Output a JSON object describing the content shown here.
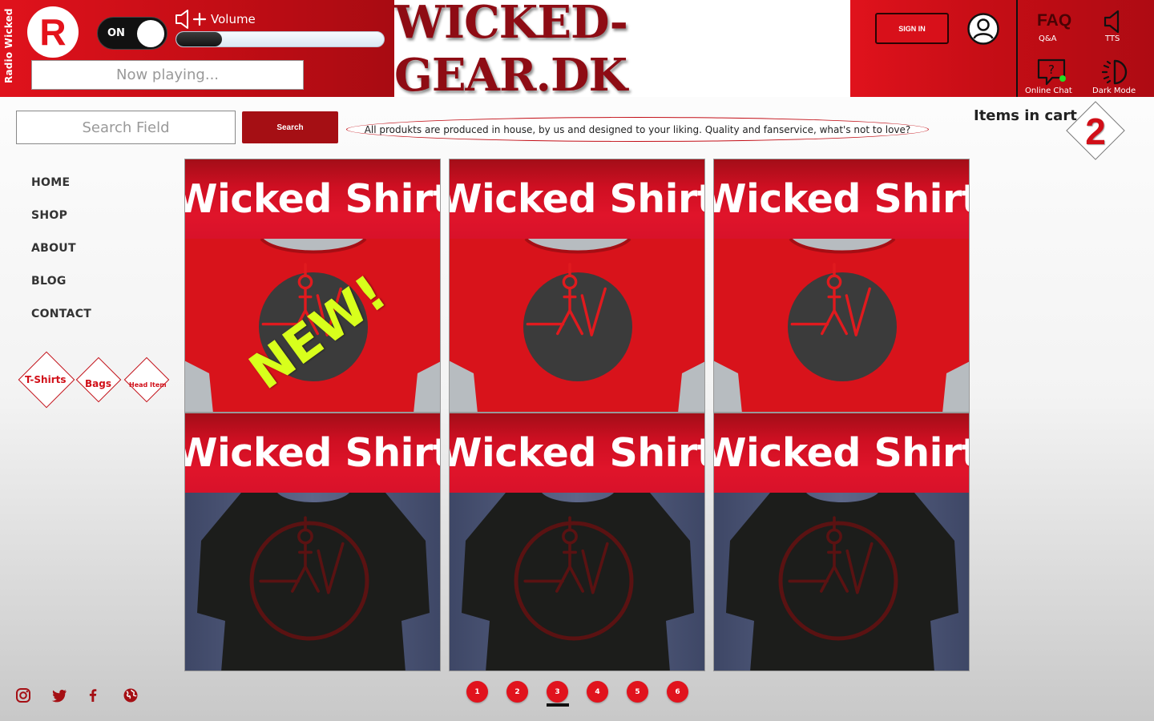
{
  "radio": {
    "vertical_label": "Radio Wicked",
    "logo_letter": "R",
    "toggle_label": "ON",
    "volume_label": "Volume",
    "volume_level": 0.22,
    "now_playing_placeholder": "Now playing..."
  },
  "brand": {
    "title": "WICKED-GEAR.DK"
  },
  "account": {
    "sign_in_label": "SIGN IN"
  },
  "tools": {
    "faq_label": "FAQ",
    "qa_label": "Q&A",
    "tts_label": "TTS",
    "chat_label": "Online Chat",
    "dark_mode_label": "Dark Mode"
  },
  "search": {
    "placeholder": "Search Field",
    "button_label": "Search"
  },
  "promo_text": "All produkts are produced in house, by us and designed to your liking. Quality and fanservice, what's not to love?",
  "cart": {
    "label": "Items in cart",
    "count": "2"
  },
  "nav": {
    "items": [
      {
        "label": "HOME"
      },
      {
        "label": "SHOP"
      },
      {
        "label": "ABOUT"
      },
      {
        "label": "BLOG"
      },
      {
        "label": "CONTACT"
      }
    ]
  },
  "categories": [
    {
      "label": "T-Shirts"
    },
    {
      "label": "Bags"
    },
    {
      "label": "Head Item"
    }
  ],
  "products": [
    {
      "title": "Wicked Shirt",
      "badge": "NEW!",
      "shirt_color": "red"
    },
    {
      "title": "Wicked Shirt",
      "shirt_color": "red"
    },
    {
      "title": "Wicked Shirt",
      "shirt_color": "red"
    },
    {
      "title": "Wicked Shirt",
      "shirt_color": "black"
    },
    {
      "title": "Wicked Shirt",
      "shirt_color": "black"
    },
    {
      "title": "Wicked Shirt",
      "shirt_color": "black"
    }
  ],
  "social_icons": [
    "instagram-icon",
    "twitter-icon",
    "facebook-icon",
    "globe-icon"
  ],
  "pagination": {
    "pages": [
      "1",
      "2",
      "3",
      "4",
      "5",
      "6"
    ],
    "current": "3"
  },
  "colors": {
    "accent_red": "#e0121c",
    "dark_red": "#a50f14",
    "brand_text": "#8e0c14",
    "new_badge": "#d8ff1c"
  }
}
